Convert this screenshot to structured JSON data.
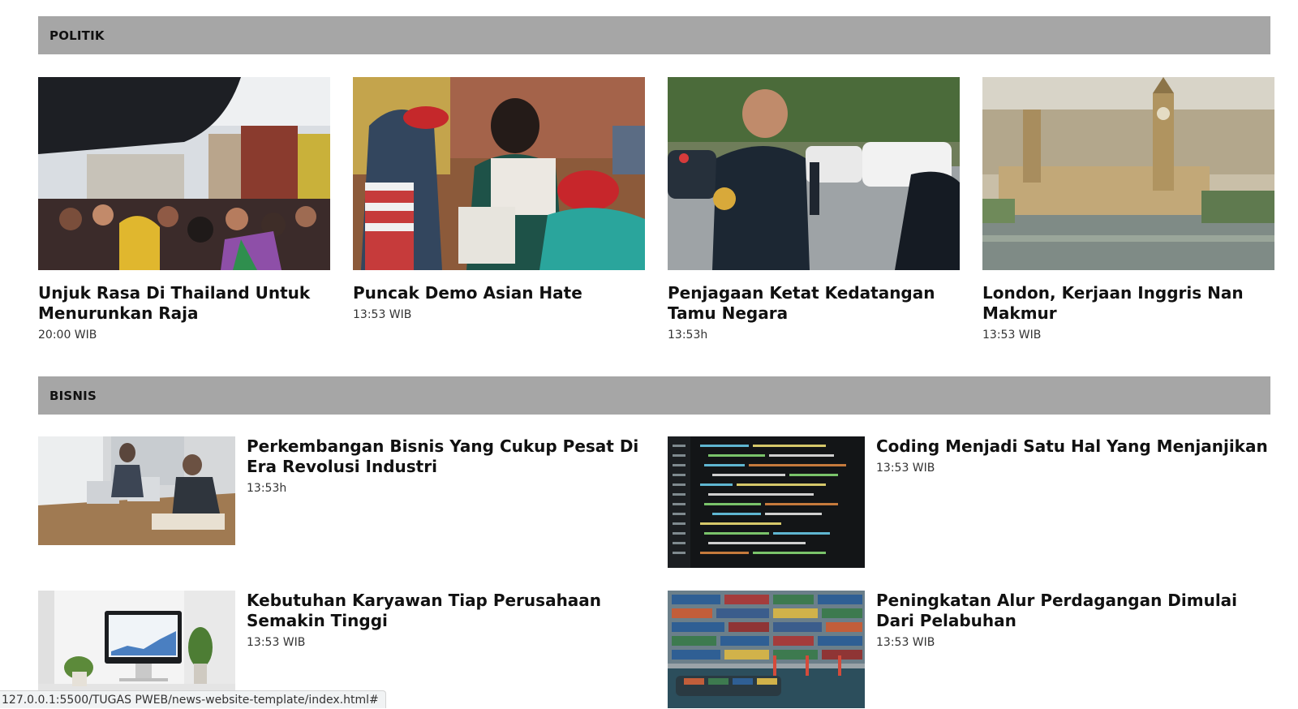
{
  "politik": {
    "title": "POLITIK",
    "articles": [
      {
        "headline": "Unjuk Rasa Di Thailand Untuk Menurunkan Raja",
        "time": "20:00 WIB"
      },
      {
        "headline": "Puncak Demo Asian Hate",
        "time": "13:53 WIB"
      },
      {
        "headline": "Penjagaan Ketat Kedatangan Tamu Negara",
        "time": "13:53h"
      },
      {
        "headline": "London, Kerjaan Inggris Nan Makmur",
        "time": "13:53 WIB"
      }
    ]
  },
  "bisnis": {
    "title": "BISNIS",
    "articles": [
      {
        "headline": "Perkembangan Bisnis Yang Cukup Pesat Di Era Revolusi Industri",
        "time": "13:53h"
      },
      {
        "headline": "Coding Menjadi Satu Hal Yang Menjanjikan",
        "time": "13:53 WIB"
      },
      {
        "headline": "Kebutuhan Karyawan Tiap Perusahaan Semakin Tinggi",
        "time": "13:53 WIB"
      },
      {
        "headline": "Peningkatan Alur Perdagangan Dimulai Dari Pelabuhan",
        "time": "13:53 WIB"
      }
    ]
  },
  "status_bar": {
    "url": "127.0.0.1:5500/TUGAS PWEB/news-website-template/index.html#"
  }
}
